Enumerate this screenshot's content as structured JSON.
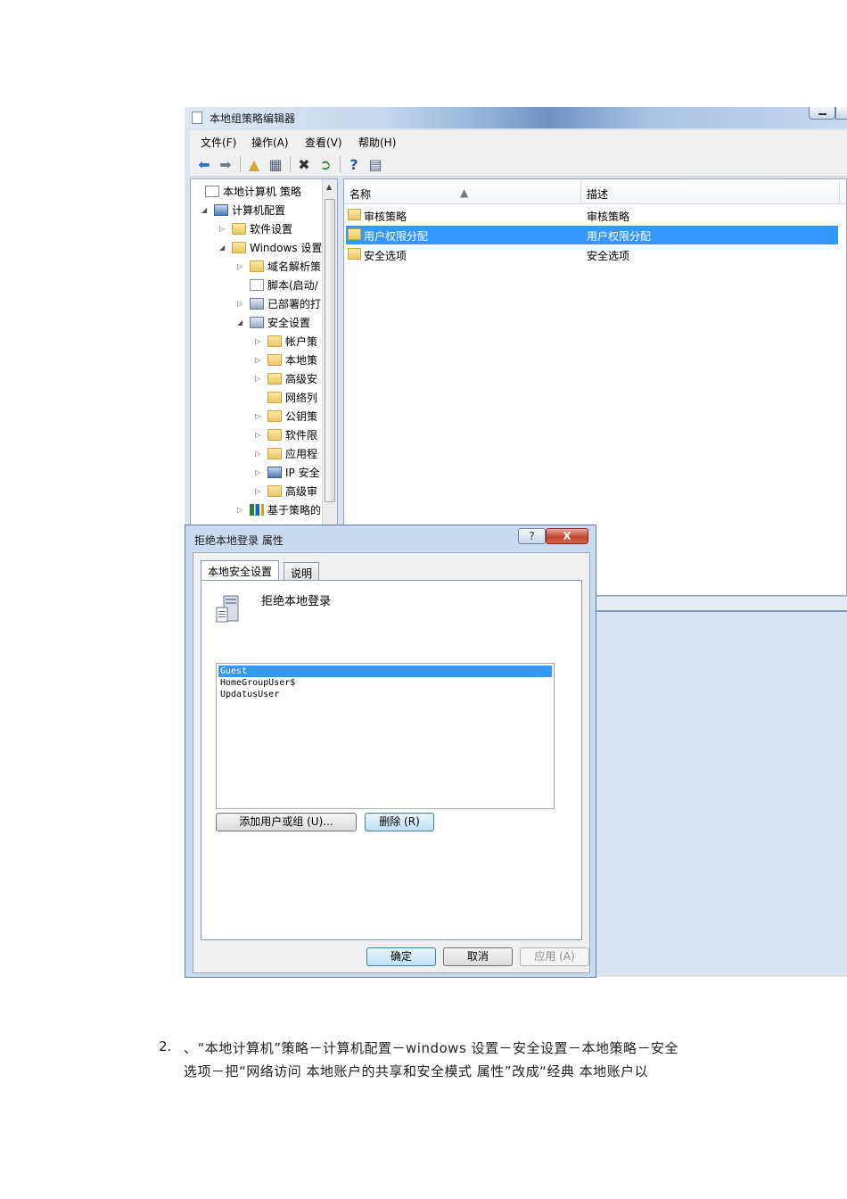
{
  "editor": {
    "title": "本地组策略编辑器",
    "menu": [
      "文件(F)",
      "操作(A)",
      "查看(V)",
      "帮助(H)"
    ],
    "tree": [
      {
        "label": "本地计算机 策略",
        "icon": "policy-doc-icon",
        "expander": ""
      },
      {
        "label": "计算机配置",
        "icon": "computer-icon",
        "expander": "◢"
      },
      {
        "label": "软件设置",
        "icon": "folder-icon",
        "expander": "▷"
      },
      {
        "label": "Windows 设置",
        "icon": "folder-icon",
        "expander": "◢"
      },
      {
        "label": "域名解析策",
        "icon": "folder-icon",
        "expander": "▷"
      },
      {
        "label": "脚本(启动/",
        "icon": "script-icon",
        "expander": ""
      },
      {
        "label": "已部署的打",
        "icon": "printer-icon",
        "expander": "▷"
      },
      {
        "label": "安全设置",
        "icon": "security-icon",
        "expander": "◢"
      },
      {
        "label": "帐户策",
        "icon": "folder-lock-icon",
        "expander": "▷"
      },
      {
        "label": "本地策",
        "icon": "folder-lock-icon",
        "expander": "▷"
      },
      {
        "label": "高级安",
        "icon": "folder-icon",
        "expander": "▷"
      },
      {
        "label": "网络列",
        "icon": "folder-icon",
        "expander": ""
      },
      {
        "label": "公钥策",
        "icon": "folder-icon",
        "expander": "▷"
      },
      {
        "label": "软件限",
        "icon": "folder-icon",
        "expander": "▷"
      },
      {
        "label": "应用程",
        "icon": "folder-icon",
        "expander": "▷"
      },
      {
        "label": "IP 安全",
        "icon": "ip-security-icon",
        "expander": "▷"
      },
      {
        "label": "高级审",
        "icon": "folder-icon",
        "expander": "▷"
      },
      {
        "label": "基于策略的",
        "icon": "chart-icon",
        "expander": "▷"
      }
    ],
    "list": {
      "columns": [
        "名称",
        "描述"
      ],
      "rows": [
        {
          "name": "审核策略",
          "desc": "审核策略",
          "selected": false
        },
        {
          "name": "用户权限分配",
          "desc": "用户权限分配",
          "selected": true
        },
        {
          "name": "安全选项",
          "desc": "安全选项",
          "selected": false
        }
      ]
    }
  },
  "dialog": {
    "title": "拒绝本地登录 属性",
    "help_glyph": "?",
    "close_glyph": "X",
    "tabs": [
      "本地安全设置",
      "说明"
    ],
    "policy_name": "拒绝本地登录",
    "users": [
      {
        "name": "Guest",
        "selected": true
      },
      {
        "name": "HomeGroupUser$",
        "selected": false
      },
      {
        "name": "UpdatusUser",
        "selected": false
      }
    ],
    "add_button": "添加用户或组 (U)...",
    "remove_button": "删除 (R)",
    "ok_button": "确定",
    "cancel_button": "取消",
    "apply_button": "应用 (A)"
  },
  "doc": {
    "item_number": "2.",
    "line1": "、“本地计算机”策略－计算机配置－windows 设置－安全设置－本地策略－安全",
    "line2": "选项－把“网络访问 本地账户的共享和安全模式 属性”改成“经典 本地账户以"
  },
  "colors": {
    "selection": "#3399ff",
    "window_frame": "#c9dbef",
    "close_button": "#c4472f"
  }
}
